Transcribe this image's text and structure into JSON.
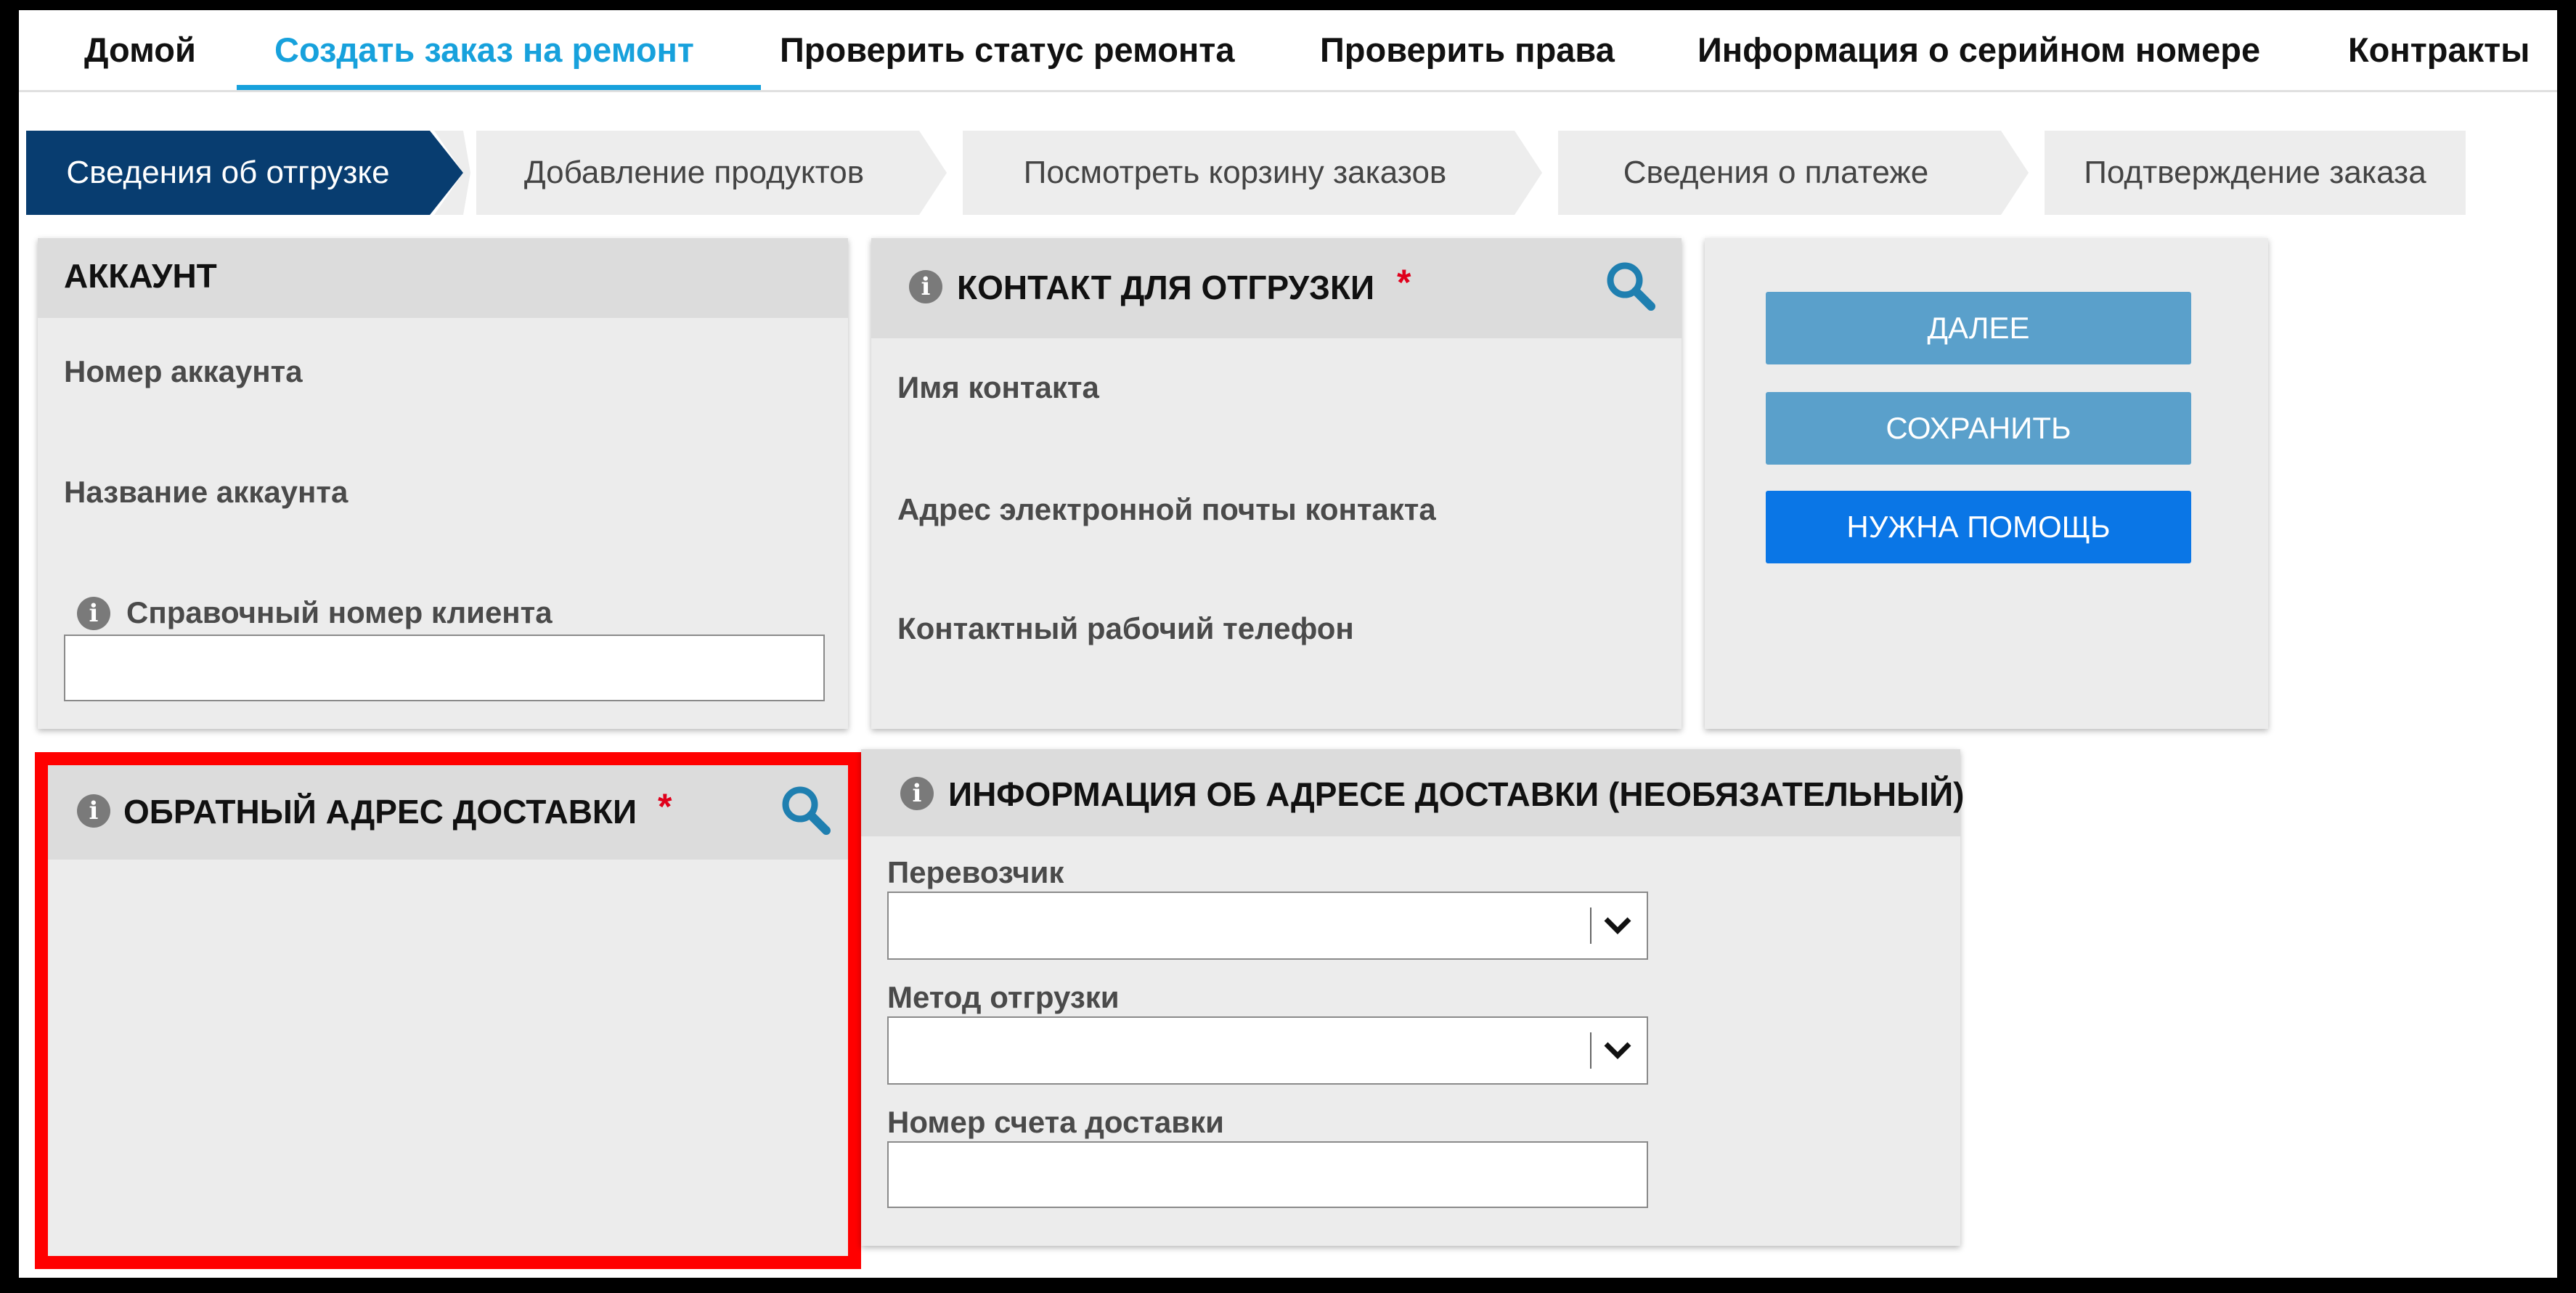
{
  "nav": {
    "items": [
      "Домой",
      "Создать заказ на ремонт",
      "Проверить статус ремонта",
      "Проверить права",
      "Информация о серийном номере",
      "Контракты"
    ],
    "active_index": 1
  },
  "steps": {
    "items": [
      "Сведения об отгрузке",
      "Добавление продуктов",
      "Посмотреть корзину заказов",
      "Сведения о платеже",
      "Подтверждение заказа"
    ],
    "active_index": 0
  },
  "account": {
    "title": "АККАУНТ",
    "number_label": "Номер аккаунта",
    "name_label": "Название аккаунта",
    "ref_label": "Справочный номер клиента",
    "ref_value": ""
  },
  "shipping_contact": {
    "title": "КОНТАКТ ДЛЯ ОТГРУЗКИ",
    "required_mark": "*",
    "name_label": "Имя контакта",
    "email_label": "Адрес электронной почты контакта",
    "phone_label": "Контактный рабочий телефон"
  },
  "actions": {
    "next_label": "ДАЛЕЕ",
    "save_label": "СОХРАНИТЬ",
    "help_label": "НУЖНА ПОМОЩЬ"
  },
  "return_address": {
    "title": "ОБРАТНЫЙ АДРЕС ДОСТАВКИ",
    "required_mark": "*"
  },
  "delivery_info": {
    "title": "ИНФОРМАЦИЯ ОБ АДРЕСЕ ДОСТАВКИ (НЕОБЯЗАТЕЛЬНЫЙ)",
    "carrier_label": "Перевозчик",
    "carrier_value": "",
    "method_label": "Метод отгрузки",
    "method_value": "",
    "account_label": "Номер счета доставки",
    "account_value": ""
  },
  "colors": {
    "nav_active": "#17a1dc",
    "step_active": "#083d70",
    "button_primary": "#5aa0cb",
    "button_help": "#0a76e6",
    "required": "#e0001b",
    "search_icon": "#1f7fb0",
    "highlight": "#ff0000"
  },
  "icons": [
    "info-icon",
    "search-icon",
    "chevron-down-icon"
  ]
}
